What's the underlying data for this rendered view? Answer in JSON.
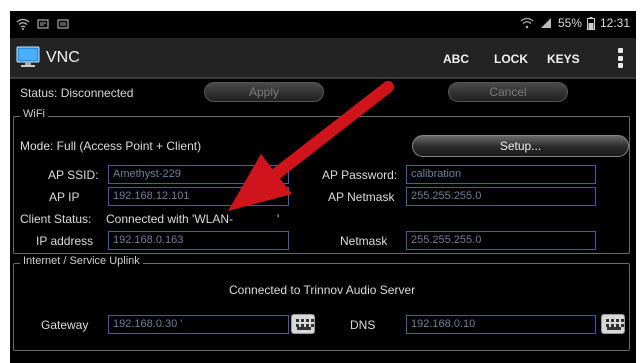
{
  "status_bar": {
    "battery": "55%",
    "time": "12:31"
  },
  "app": {
    "title": "VNC"
  },
  "toolbar": {
    "abc": "ABC",
    "lock": "LOCK",
    "keys": "KEYS"
  },
  "status": {
    "label": "Status: Disconnected",
    "apply": "Apply",
    "cancel": "Cancel"
  },
  "wifi": {
    "title": "WiFi",
    "mode_label": "Mode: Full (Access Point + Client)",
    "setup_button": "Setup...",
    "ap_ssid_label": "AP SSID:",
    "ap_ssid": "Amethyst-229",
    "ap_password_label": "AP Password:",
    "ap_password": "calibration",
    "ap_ip_label": "AP IP",
    "ap_ip": "192.168.12.101",
    "ap_netmask_label": "AP Netmask",
    "ap_netmask": "255.255.255.0",
    "client_status_label": "Client Status:",
    "client_status": "Connected with 'WLAN-",
    "client_status_end": "'",
    "ip_address_label": "IP address",
    "ip_address": "192.168.0.163",
    "netmask_label": "Netmask",
    "netmask": "255.255.255.0"
  },
  "uplink": {
    "title": "Internet / Service Uplink",
    "connection": "Connected to Trinnov Audio Server",
    "gateway_label": "Gateway",
    "gateway": "192.168.0.30 '",
    "dns_label": "DNS",
    "dns": "192.168.0.10"
  },
  "colors": {
    "field_border": "#3a5fb0",
    "arrow": "#d0141c",
    "background": "#000000"
  },
  "icons": [
    "wifi-icon",
    "signal-icon",
    "battery-icon",
    "monitor-icon",
    "keyboard-icon",
    "overflow-menu-icon"
  ]
}
